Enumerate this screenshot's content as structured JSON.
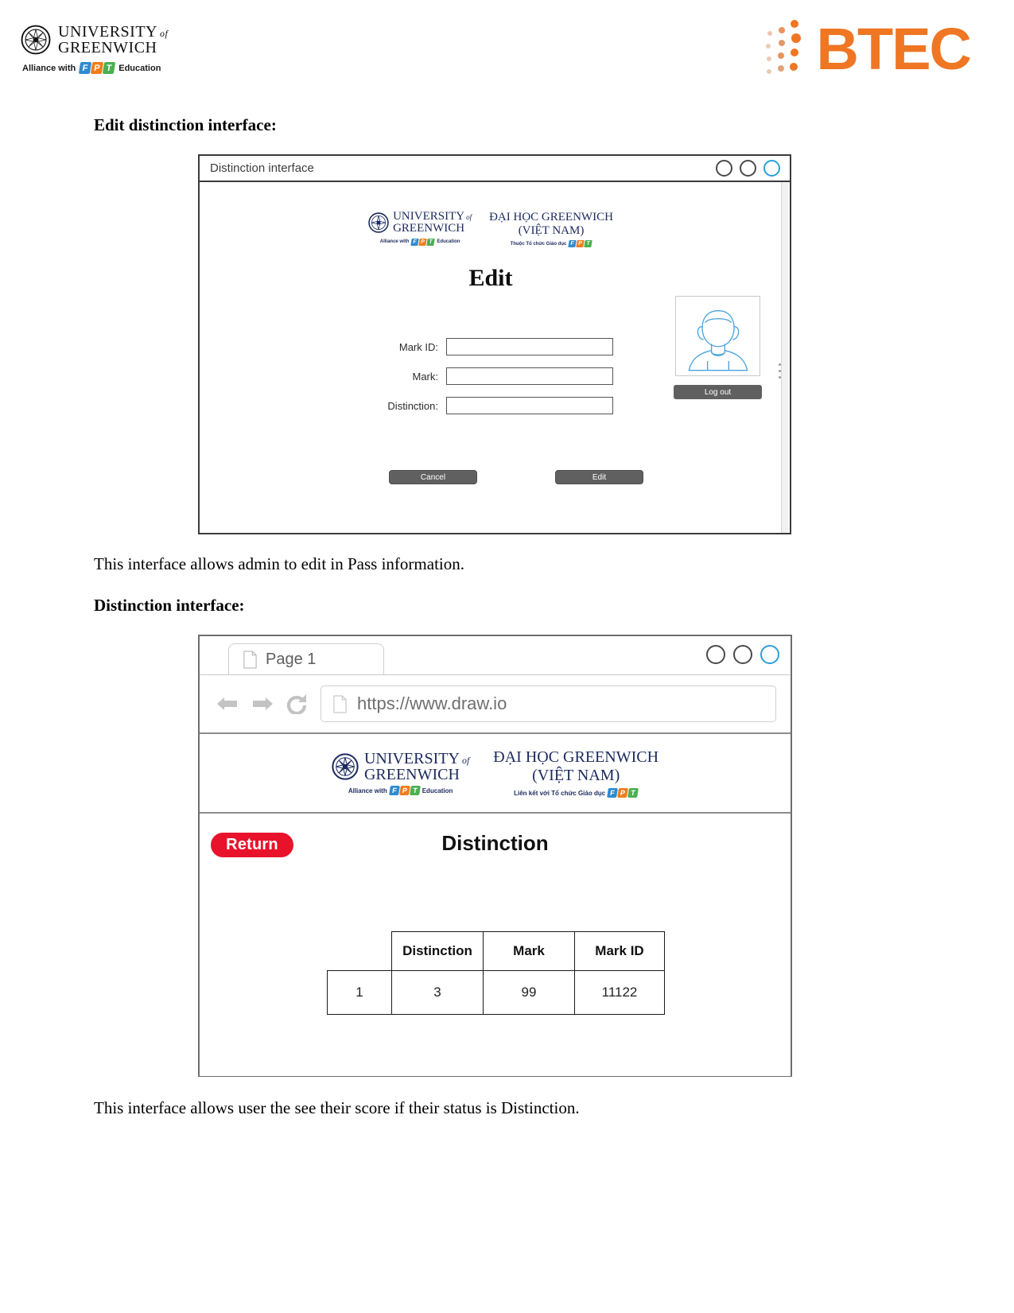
{
  "page_header": {
    "university_line1": "UNIVERSITY",
    "university_of": "of",
    "university_line2": "GREENWICH",
    "alliance_prefix": "Alliance with",
    "alliance_suffix": "Education",
    "fpt_letters": [
      "F",
      "P",
      "T"
    ],
    "btec_label": "BTEC",
    "btec_color": "#ef7622"
  },
  "sections": {
    "edit_heading": "Edit distinction interface:",
    "edit_caption": "This interface allows admin to edit in Pass information.",
    "distinction_heading": "Distinction interface:",
    "distinction_caption": "This interface allows user the see their score if their status is Distinction."
  },
  "mockup_edit": {
    "window_title": "Distinction interface",
    "window_controls": [
      "minimize",
      "maximize",
      "close"
    ],
    "logo": {
      "left_line1": "UNIVERSITY",
      "left_of": "of",
      "left_line2": "GREENWICH",
      "left_sub_prefix": "Alliance with",
      "left_sub_suffix": "Education",
      "right_line1": "ĐẠI HỌC GREENWICH",
      "right_line2": "(VIỆT NAM)",
      "right_sub_prefix": "Thuộc Tổ chức Giáo dục"
    },
    "title": "Edit",
    "fields": [
      {
        "label": "Mark ID:",
        "value": "",
        "placeholder": ""
      },
      {
        "label": "Mark:",
        "value": "",
        "placeholder": ""
      },
      {
        "label": "Distinction:",
        "value": "",
        "placeholder": ""
      }
    ],
    "buttons": {
      "cancel": "Cancel",
      "submit": "Edit"
    },
    "sidebar": {
      "avatar_alt": "user-avatar",
      "logout": "Log out"
    }
  },
  "mockup_browser": {
    "tab_label": "Page 1",
    "window_controls": [
      "minimize",
      "maximize",
      "close"
    ],
    "nav_icons": [
      "back-arrow",
      "forward-arrow",
      "reload"
    ],
    "url": "https://www.draw.io",
    "banner": {
      "left_line1": "UNIVERSITY",
      "left_of": "of",
      "left_line2": "GREENWICH",
      "left_sub_prefix": "Alliance with",
      "left_sub_suffix": "Education",
      "right_line1": "ĐẠI HỌC GREENWICH",
      "right_line2": "(VIỆT NAM)",
      "right_sub_prefix": "Liên kết với Tổ chức Giáo dục"
    },
    "return_button": "Return",
    "return_color": "#e8132b",
    "page_title": "Distinction",
    "table": {
      "headers": [
        "",
        "Distinction",
        "Mark",
        "Mark ID"
      ],
      "rows": [
        [
          "1",
          "3",
          "99",
          "11122"
        ]
      ]
    }
  }
}
